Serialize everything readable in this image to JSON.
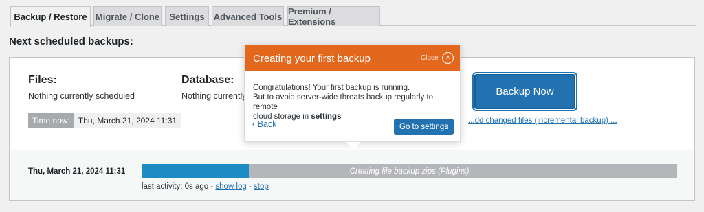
{
  "tabs": [
    {
      "label": "Backup / Restore",
      "active": true
    },
    {
      "label": "Migrate / Clone",
      "active": false
    },
    {
      "label": "Settings",
      "active": false
    },
    {
      "label": "Advanced Tools",
      "active": false
    },
    {
      "label": "Premium / Extensions",
      "active": false
    }
  ],
  "section_title": "Next scheduled backups:",
  "schedule": {
    "files_title": "Files:",
    "files_status": "Nothing currently scheduled",
    "database_title": "Database:",
    "database_status": "Nothing currently scheduled",
    "time_now_label": "Time now:",
    "time_now_value": "Thu, March 21, 2024 11:31"
  },
  "backup_now_label": "Backup Now",
  "incremental_link": "...dd changed files (incremental backup) ...",
  "activity": {
    "date": "Thu, March 21, 2024 11:31",
    "progress_percent": 20,
    "progress_label": "Creating file backup zips (Plugins)",
    "last_activity": "last activity: 0s ago - ",
    "show_log": "show log",
    "separator": " - ",
    "stop": "stop"
  },
  "popup": {
    "title": "Creating your first backup",
    "close_label": "Close",
    "close_icon": "×",
    "line1": "Congratulations! Your first backup is running.",
    "line2": "But to avoid server-wide threats backup regularly to remote",
    "line3_pre": "cloud storage in ",
    "line3_bold": "settings",
    "back_label": "Back",
    "back_icon": "‹",
    "go_label": "Go to settings"
  },
  "colors": {
    "accent_blue": "#2271b1",
    "popup_header": "#e3681e",
    "progress_fill": "#1d8bc4"
  }
}
